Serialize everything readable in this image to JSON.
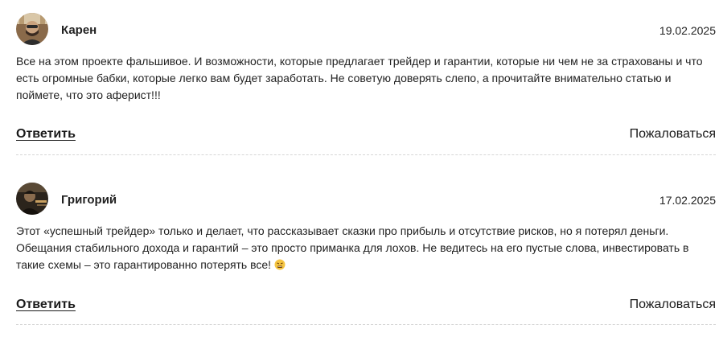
{
  "comments": [
    {
      "author": "Карен",
      "date": "19.02.2025",
      "avatar_icon": "user-avatar-photo",
      "text": "Все на этом проекте фальшивое. И возможности, которые предлагает трейдер и гарантии, которые ни чем не за страхованы и что есть огромные бабки, которые легко вам будет заработать. Не советую доверять слепо, а прочитайте внимательно статью и поймете, что это аферист!!!",
      "reply_label": "Ответить",
      "report_label": "Пожаловаться"
    },
    {
      "author": "Григорий",
      "date": "17.02.2025",
      "avatar_icon": "user-avatar-photo",
      "text": "Этот «успешный трейдер» только и делает, что рассказывает сказки про прибыль и отсутствие рисков, но я потерял деньги. Обещания стабильного дохода и гарантий – это просто приманка для лохов. Не ведитесь на его пустые слова, инвестировать в такие схемы – это гарантированно потерять все!",
      "emoji_icon": "angry-face-emoji-icon",
      "reply_label": "Ответить",
      "report_label": "Пожаловаться"
    }
  ],
  "colors": {
    "text": "#222222",
    "divider": "#d6d6d6",
    "background": "#ffffff"
  }
}
